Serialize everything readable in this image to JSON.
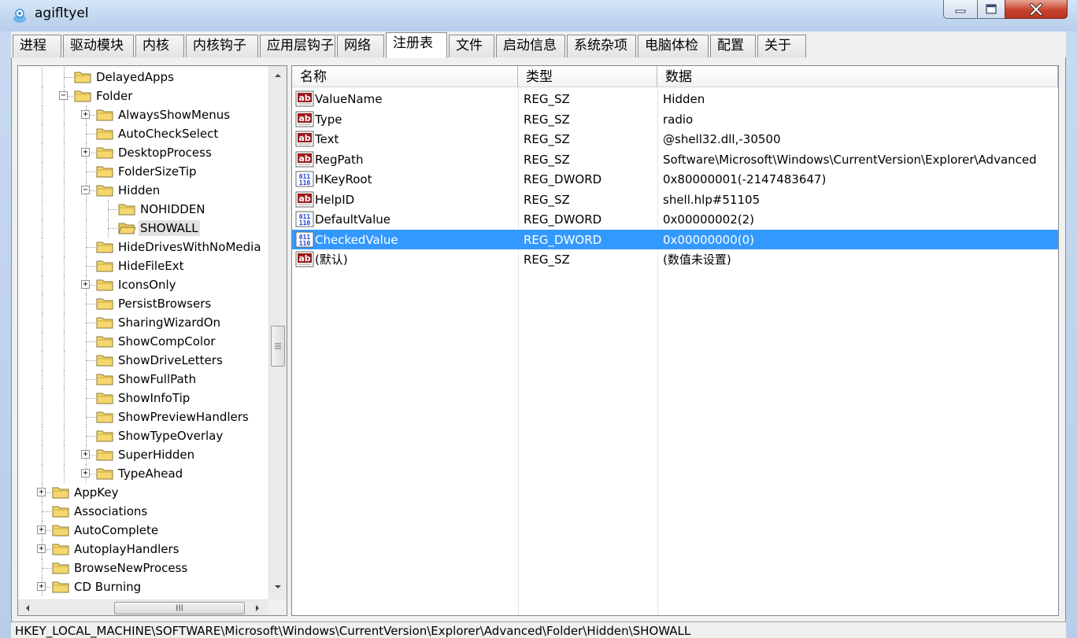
{
  "window": {
    "title": "agifltyel",
    "icon": "app-logo-icon",
    "controls": [
      "minimize-icon",
      "maximize-icon",
      "close-icon"
    ]
  },
  "tabs": [
    {
      "label": "进程"
    },
    {
      "label": "驱动模块"
    },
    {
      "label": "内核"
    },
    {
      "label": "内核钩子"
    },
    {
      "label": "应用层钩子"
    },
    {
      "label": "网络"
    },
    {
      "label": "注册表",
      "active": true
    },
    {
      "label": "文件"
    },
    {
      "label": "启动信息"
    },
    {
      "label": "系统杂项"
    },
    {
      "label": "电脑体检"
    },
    {
      "label": "配置"
    },
    {
      "label": "关于"
    }
  ],
  "tree": {
    "items": [
      {
        "label": "DelayedApps",
        "level": 2,
        "expander": "none",
        "open": false
      },
      {
        "label": "Folder",
        "level": 2,
        "expander": "minus",
        "open": false
      },
      {
        "label": "AlwaysShowMenus",
        "level": 3,
        "expander": "plus",
        "open": false
      },
      {
        "label": "AutoCheckSelect",
        "level": 3,
        "expander": "none",
        "open": false
      },
      {
        "label": "DesktopProcess",
        "level": 3,
        "expander": "plus",
        "open": false
      },
      {
        "label": "FolderSizeTip",
        "level": 3,
        "expander": "none",
        "open": false
      },
      {
        "label": "Hidden",
        "level": 3,
        "expander": "minus",
        "open": false
      },
      {
        "label": "NOHIDDEN",
        "level": 4,
        "expander": "none",
        "open": false
      },
      {
        "label": "SHOWALL",
        "level": 4,
        "expander": "none",
        "open": true,
        "selected": true
      },
      {
        "label": "HideDrivesWithNoMedia",
        "level": 3,
        "expander": "none",
        "open": false
      },
      {
        "label": "HideFileExt",
        "level": 3,
        "expander": "none",
        "open": false
      },
      {
        "label": "IconsOnly",
        "level": 3,
        "expander": "plus",
        "open": false
      },
      {
        "label": "PersistBrowsers",
        "level": 3,
        "expander": "none",
        "open": false
      },
      {
        "label": "SharingWizardOn",
        "level": 3,
        "expander": "none",
        "open": false
      },
      {
        "label": "ShowCompColor",
        "level": 3,
        "expander": "none",
        "open": false
      },
      {
        "label": "ShowDriveLetters",
        "level": 3,
        "expander": "none",
        "open": false
      },
      {
        "label": "ShowFullPath",
        "level": 3,
        "expander": "none",
        "open": false
      },
      {
        "label": "ShowInfoTip",
        "level": 3,
        "expander": "none",
        "open": false
      },
      {
        "label": "ShowPreviewHandlers",
        "level": 3,
        "expander": "none",
        "open": false
      },
      {
        "label": "ShowTypeOverlay",
        "level": 3,
        "expander": "none",
        "open": false
      },
      {
        "label": "SuperHidden",
        "level": 3,
        "expander": "plus",
        "open": false
      },
      {
        "label": "TypeAhead",
        "level": 3,
        "expander": "plus",
        "open": false
      },
      {
        "label": "AppKey",
        "level": 1,
        "expander": "plus",
        "open": false
      },
      {
        "label": "Associations",
        "level": 1,
        "expander": "none",
        "open": false
      },
      {
        "label": "AutoComplete",
        "level": 1,
        "expander": "plus",
        "open": false
      },
      {
        "label": "AutoplayHandlers",
        "level": 1,
        "expander": "plus",
        "open": false
      },
      {
        "label": "BrowseNewProcess",
        "level": 1,
        "expander": "none",
        "open": false
      },
      {
        "label": "CD Burning",
        "level": 1,
        "expander": "plus",
        "open": false
      }
    ],
    "scroll_grip": "III"
  },
  "list": {
    "columns": [
      "名称",
      "类型",
      "数据"
    ],
    "rows": [
      {
        "icon": "string-value-icon",
        "name": "ValueName",
        "type": "REG_SZ",
        "data": "Hidden"
      },
      {
        "icon": "string-value-icon",
        "name": "Type",
        "type": "REG_SZ",
        "data": "radio"
      },
      {
        "icon": "string-value-icon",
        "name": "Text",
        "type": "REG_SZ",
        "data": "@shell32.dll,-30500"
      },
      {
        "icon": "string-value-icon",
        "name": "RegPath",
        "type": "REG_SZ",
        "data": "Software\\Microsoft\\Windows\\CurrentVersion\\Explorer\\Advanced"
      },
      {
        "icon": "binary-value-icon",
        "name": "HKeyRoot",
        "type": "REG_DWORD",
        "data": "0x80000001(-2147483647)"
      },
      {
        "icon": "string-value-icon",
        "name": "HelpID",
        "type": "REG_SZ",
        "data": "shell.hlp#51105"
      },
      {
        "icon": "binary-value-icon",
        "name": "DefaultValue",
        "type": "REG_DWORD",
        "data": "0x00000002(2)"
      },
      {
        "icon": "binary-value-icon",
        "name": "CheckedValue",
        "type": "REG_DWORD",
        "data": "0x00000000(0)",
        "selected": true
      },
      {
        "icon": "string-value-icon",
        "name": "(默认)",
        "type": "REG_SZ",
        "data": "(数值未设置)"
      }
    ]
  },
  "status": {
    "path": "HKEY_LOCAL_MACHINE\\SOFTWARE\\Microsoft\\Windows\\CurrentVersion\\Explorer\\Advanced\\Folder\\Hidden\\SHOWALL"
  },
  "colors": {
    "selection": "#3399ff",
    "folder": "#f5d76e",
    "string_icon": "#9b1b1b",
    "binary_icon": "#1a3fd6"
  }
}
